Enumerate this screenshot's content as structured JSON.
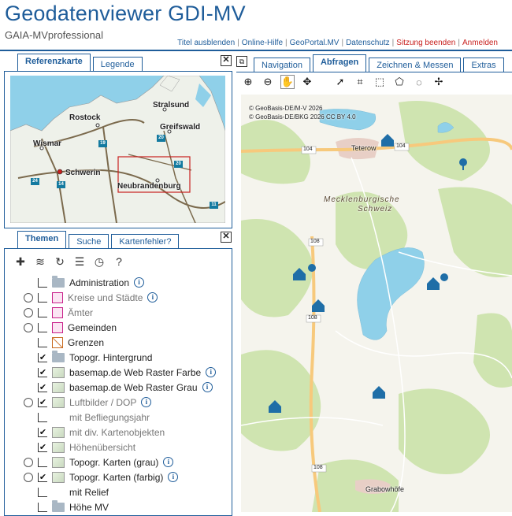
{
  "header": {
    "title": "Geodatenviewer GDI-MV",
    "subtitle": "GAIA-MVprofessional",
    "links": [
      {
        "label": "Titel ausblenden",
        "color": "blue"
      },
      {
        "label": "Online-Hilfe",
        "color": "blue"
      },
      {
        "label": "GeoPortal.MV",
        "color": "blue"
      },
      {
        "label": "Datenschutz",
        "color": "blue"
      },
      {
        "label": "Sitzung beenden",
        "color": "red"
      },
      {
        "label": "Anmelden",
        "color": "red"
      }
    ]
  },
  "left_top_tabs": [
    "Referenzkarte",
    "Legende"
  ],
  "reference_map": {
    "cities": [
      "Stralsund",
      "Rostock",
      "Greifswald",
      "Wismar",
      "Schwerin",
      "Neubrandenburg"
    ],
    "shields": [
      "20",
      "19",
      "24",
      "14",
      "20",
      "11"
    ]
  },
  "left_bottom_tabs": [
    "Themen",
    "Suche",
    "Kartenfehler?"
  ],
  "themes_tree": [
    {
      "label": "Administration",
      "kind": "folder",
      "info": true
    },
    {
      "label": "Kreise und Städte",
      "kind": "layer",
      "info": true,
      "grey": true
    },
    {
      "label": "Ämter",
      "kind": "layer",
      "grey": true
    },
    {
      "label": "Gemeinden",
      "kind": "layer"
    },
    {
      "label": "Grenzen",
      "kind": "layer"
    },
    {
      "label": "Topogr. Hintergrund",
      "kind": "folder",
      "checked": true
    },
    {
      "label": "basemap.de Web Raster Farbe",
      "kind": "layer",
      "checked": true,
      "info": true
    },
    {
      "label": "basemap.de Web Raster Grau",
      "kind": "layer",
      "checked": true,
      "info": true
    },
    {
      "label": "Luftbilder / DOP",
      "kind": "layer",
      "info": true,
      "grey": true
    },
    {
      "label": "mit Befliegungsjahr",
      "kind": "layer",
      "grey": true
    },
    {
      "label": "mit div. Kartenobjekten",
      "kind": "layer",
      "grey": true
    },
    {
      "label": "Höhenübersicht",
      "kind": "layer",
      "grey": true
    },
    {
      "label": "Topogr. Karten (grau)",
      "kind": "layer",
      "info": true
    },
    {
      "label": "Topogr. Karten (farbig)",
      "kind": "layer",
      "checked": true,
      "info": true
    },
    {
      "label": "mit Relief",
      "kind": "layer"
    },
    {
      "label": "Höhe MV",
      "kind": "folder"
    }
  ],
  "map_tabs": [
    "Navigation",
    "Abfragen",
    "Zeichnen & Messen",
    "Extras"
  ],
  "map": {
    "copyright": [
      "© GeoBasis-DE/M-V 2026",
      "© GeoBasis-DE/BKG 2026 CC BY 4.0"
    ],
    "labels": [
      "Teterow",
      "Mecklenburgische",
      "Schweiz",
      "Grabowhöfe"
    ],
    "road_numbers": [
      "104",
      "104",
      "108",
      "108",
      "108"
    ]
  },
  "colors": {
    "accent": "#1f5d9a",
    "danger": "#c8201e"
  }
}
